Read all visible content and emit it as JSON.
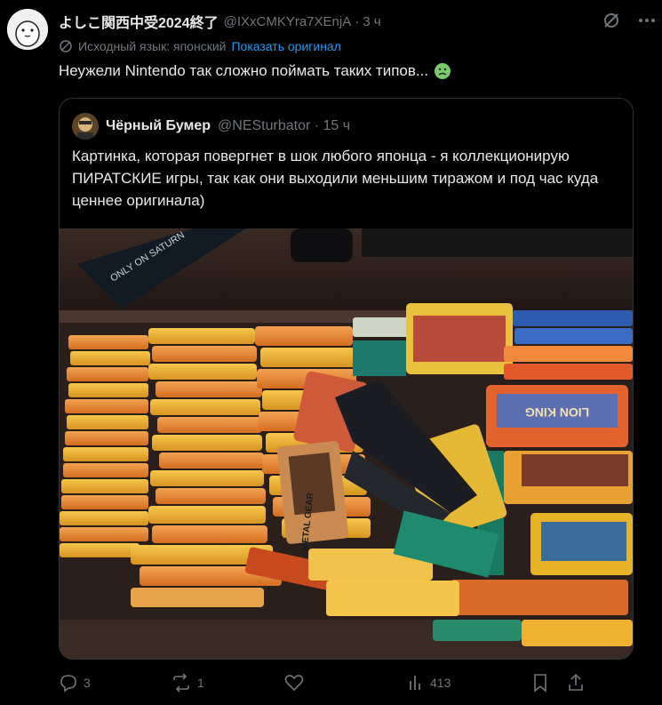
{
  "post": {
    "display_name": "よしこ関西中受2024終了",
    "handle": "@IXxCMKYra7XEnjA",
    "time": "· 3 ч",
    "translate_note": "Исходный язык: японский",
    "translate_link": "Показать оригинал",
    "text": "Неужели Nintendo так сложно поймать таких типов..."
  },
  "quote": {
    "display_name": "Чёрный Бумер",
    "handle": "@NESturbator · 15 ч",
    "text": "Картинка, которая повергнет в шок любого японца - я коллекционирую ПИРАТСКИЕ игры, так как они выходили меньшим тиражом и под час куда ценнее оригинала)"
  },
  "actions": {
    "reply_count": "3",
    "repost_count": "1",
    "like_count": "",
    "views_count": "413"
  },
  "image_labels": {
    "box_text": "ONLY ON SATURN",
    "lion_king": "LION KING",
    "metal_gear": "METAL GEAR"
  },
  "colors": {
    "background": "#000000",
    "text": "#e7e9ea",
    "muted": "#71767b",
    "link": "#1d9bf0",
    "border": "#2f3336"
  },
  "icons": [
    "avatar",
    "grok-icon",
    "more-icon",
    "translate-icon",
    "sick-emoji",
    "reply-icon",
    "repost-icon",
    "like-icon",
    "views-icon",
    "bookmark-icon",
    "share-icon"
  ]
}
